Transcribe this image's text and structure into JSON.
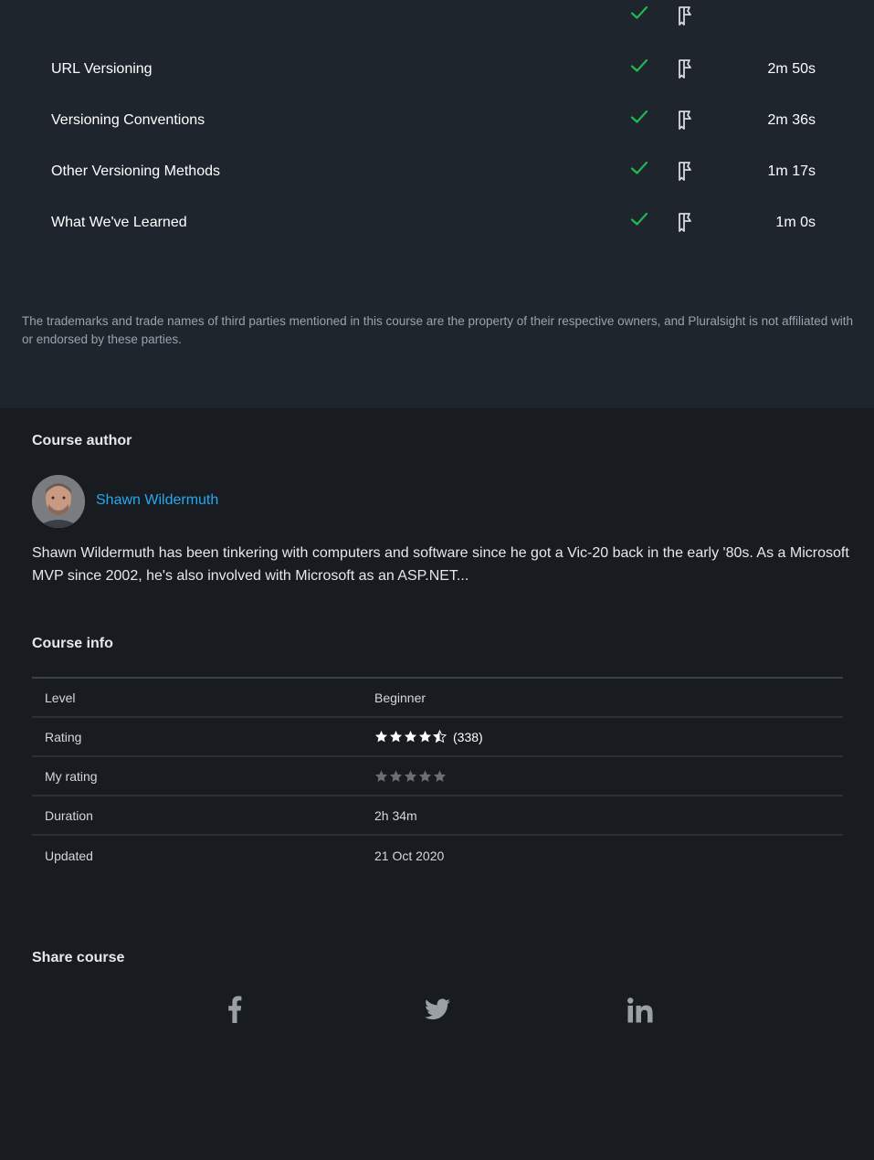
{
  "clips": [
    {
      "title": "",
      "duration": "",
      "completed": true
    },
    {
      "title": "URL Versioning",
      "duration": "2m 50s",
      "completed": true
    },
    {
      "title": "Versioning Conventions",
      "duration": "2m 36s",
      "completed": true
    },
    {
      "title": "Other Versioning Methods",
      "duration": "1m 17s",
      "completed": true
    },
    {
      "title": "What We've Learned",
      "duration": "1m 0s",
      "completed": true
    }
  ],
  "disclaimer": "The trademarks and trade names of third parties mentioned in this course are the property of their respective owners, and Pluralsight is not affiliated with or endorsed by these parties.",
  "author": {
    "heading": "Course author",
    "name": "Shawn Wildermuth",
    "bio": "Shawn Wildermuth has been tinkering with computers and software since he got a Vic-20 back in the early '80s. As a Microsoft MVP since 2002, he's also involved with Microsoft as an ASP.NET..."
  },
  "course_info": {
    "heading": "Course info",
    "level_label": "Level",
    "level_value": "Beginner",
    "rating_label": "Rating",
    "rating_stars": 4.5,
    "rating_count": "(338)",
    "my_rating_label": "My rating",
    "my_rating_stars": 0,
    "duration_label": "Duration",
    "duration_value": "2h 34m",
    "updated_label": "Updated",
    "updated_value": "21 Oct 2020"
  },
  "share": {
    "heading": "Share course",
    "icons": [
      "facebook-icon",
      "twitter-icon",
      "linkedin-icon"
    ]
  },
  "colors": {
    "accent_link": "#23aaf0",
    "check": "#1db954",
    "toc_bg": "#1f252d",
    "page_bg": "#181b1f"
  }
}
